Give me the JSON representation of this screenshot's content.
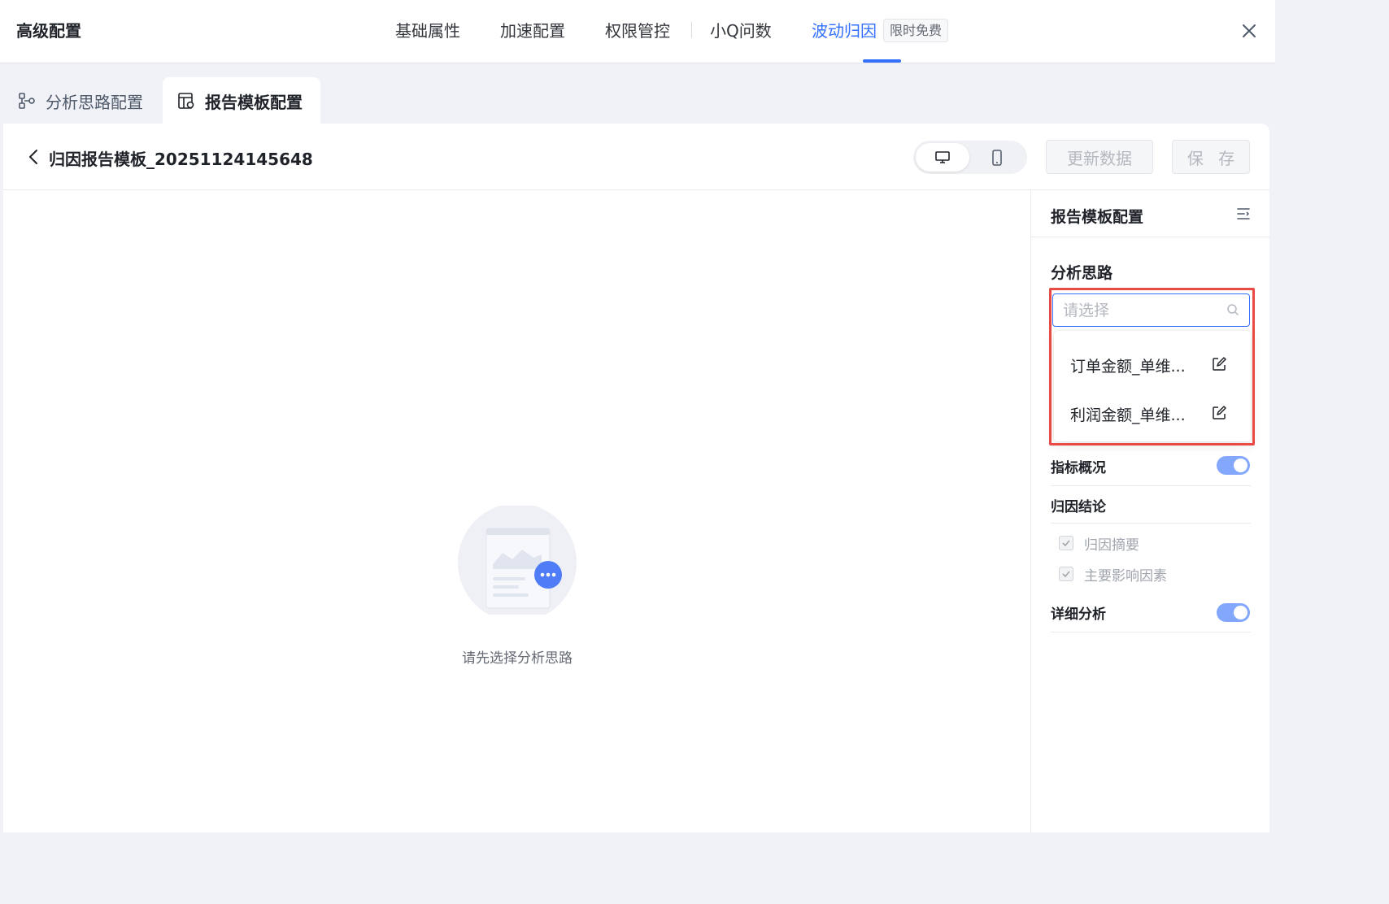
{
  "header": {
    "title": "高级配置",
    "nav": [
      {
        "label": "基础属性",
        "active": false
      },
      {
        "label": "加速配置",
        "active": false
      },
      {
        "label": "权限管控",
        "active": false
      },
      {
        "label": "小Q问数",
        "active": false
      },
      {
        "label": "波动归因",
        "active": true
      }
    ],
    "badge": "限时免费",
    "accent_color": "#3370ff"
  },
  "sub_tabs": [
    {
      "label": "分析思路配置",
      "icon": "flow-nodes-icon",
      "active": false
    },
    {
      "label": "报告模板配置",
      "icon": "report-template-icon",
      "active": true
    }
  ],
  "toolbar": {
    "report_title": "归因报告模板_20251124145648",
    "device_options": [
      "desktop",
      "mobile"
    ],
    "selected_device": "desktop",
    "update_label": "更新数据",
    "save_label": "保 存"
  },
  "canvas": {
    "empty_text": "请先选择分析思路"
  },
  "panel": {
    "title": "报告模板配置",
    "section_label": "分析思路",
    "select_placeholder": "请选择",
    "options": [
      {
        "label": "订单金额_单维..."
      },
      {
        "label": "利润金额_单维..."
      }
    ],
    "rows": {
      "overview": {
        "label": "指标概况",
        "enabled": true
      },
      "conclusion": {
        "label": "归因结论"
      },
      "summary": {
        "label": "归因摘要",
        "checked": true
      },
      "factors": {
        "label": "主要影响因素",
        "checked": true
      },
      "detail": {
        "label": "详细分析",
        "enabled": true
      }
    },
    "highlight_color": "#ea4a45"
  }
}
